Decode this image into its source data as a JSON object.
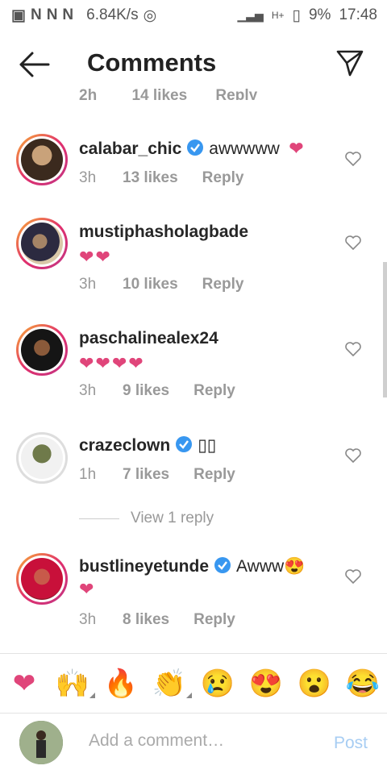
{
  "status": {
    "net_speed": "6.84K/s",
    "battery": "9%",
    "time": "17:48",
    "signal_label": "H+"
  },
  "header": {
    "title": "Comments"
  },
  "partial_row": {
    "time": "2h",
    "likes": "14 likes",
    "reply": "Reply"
  },
  "comments": [
    {
      "username": "calabar_chic",
      "verified": true,
      "text": "awwwww",
      "hearts": "❤",
      "time": "3h",
      "likes": "13 likes",
      "reply": "Reply"
    },
    {
      "username": "mustiphasholagbade",
      "verified": false,
      "text": "",
      "hearts": "❤❤",
      "time": "3h",
      "likes": "10 likes",
      "reply": "Reply"
    },
    {
      "username": "paschalinealex24",
      "verified": false,
      "text": "",
      "hearts": "❤❤❤❤",
      "time": "3h",
      "likes": "9 likes",
      "reply": "Reply"
    },
    {
      "username": "crazeclown",
      "verified": true,
      "text": "▯▯",
      "hearts": "",
      "time": "1h",
      "likes": "7 likes",
      "reply": "Reply"
    },
    {
      "username": "bustlineyetunde",
      "verified": true,
      "text": "Awww😍",
      "hearts": "❤",
      "time": "3h",
      "likes": "8 likes",
      "reply": "Reply"
    }
  ],
  "view_replies": "View 1 reply",
  "emoji_bar": [
    "❤",
    "🙌",
    "🔥",
    "👏",
    "😢",
    "😍",
    "😮",
    "😂"
  ],
  "composer": {
    "placeholder": "Add a comment…",
    "post_label": "Post"
  },
  "colors": {
    "accent": "#3897f0",
    "heart": "#e0457a",
    "post_disabled": "#a7cdf3"
  }
}
